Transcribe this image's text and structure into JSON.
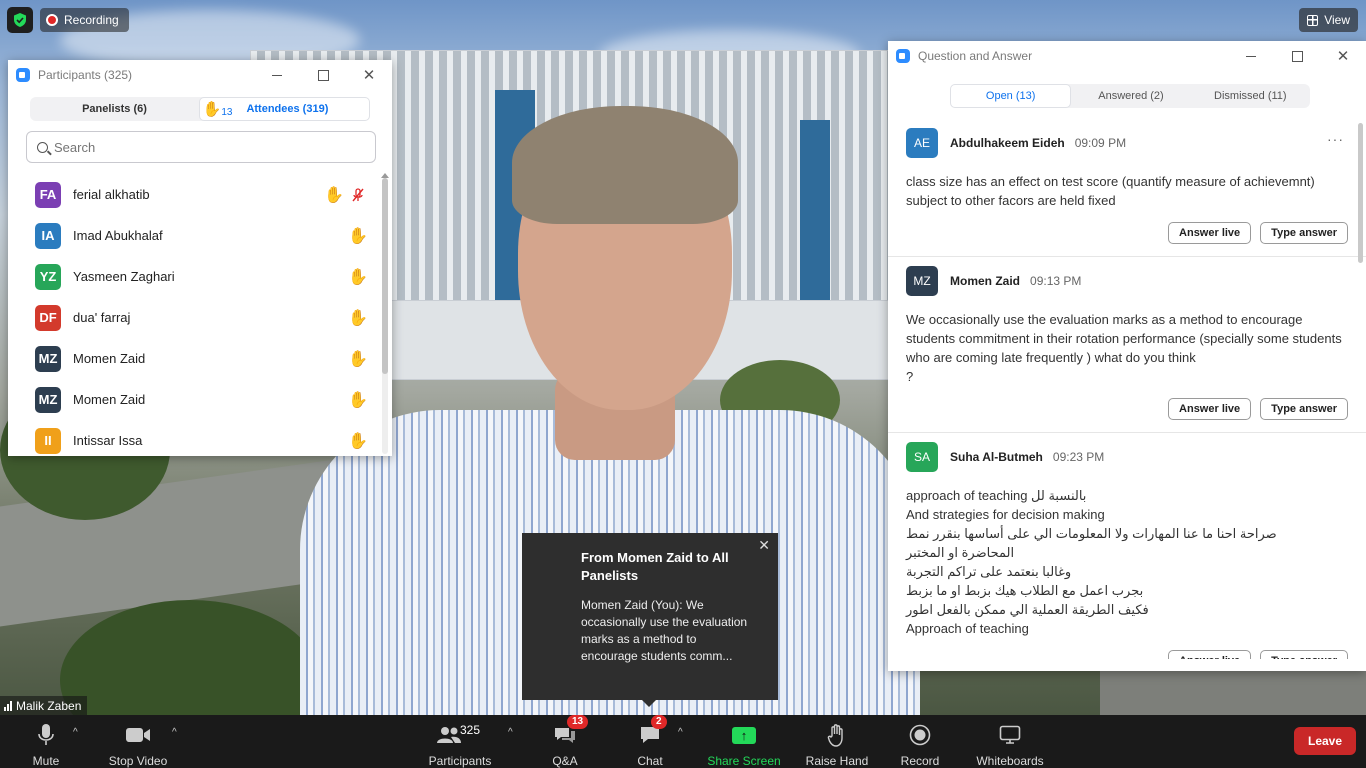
{
  "status": {
    "recording_label": "Recording",
    "view_label": "View"
  },
  "participants_window": {
    "title": "Participants (325)",
    "tabs": [
      {
        "label": "Panelists (6)"
      },
      {
        "label": "Attendees (319)"
      }
    ],
    "raised_hands_count": "13",
    "search_placeholder": "Search",
    "rows": [
      {
        "initials": "FA",
        "name": "ferial alkhatib",
        "color": "#7b3fb3",
        "hand": true,
        "mic_muted": true
      },
      {
        "initials": "IA",
        "name": "Imad Abukhalaf",
        "color": "#2b7cbf",
        "hand": true
      },
      {
        "initials": "YZ",
        "name": "Yasmeen Zaghari",
        "color": "#27a659",
        "hand": true
      },
      {
        "initials": "DF",
        "name": "dua' farraj",
        "color": "#d33a2c",
        "hand": true
      },
      {
        "initials": "MZ",
        "name": "Momen Zaid",
        "color": "#2d3e50",
        "hand": true
      },
      {
        "initials": "MZ",
        "name": "Momen Zaid",
        "color": "#2d3e50",
        "hand": true
      },
      {
        "initials": "II",
        "name": "Intissar Issa",
        "color": "#f0a01a",
        "hand": true
      }
    ]
  },
  "qa_window": {
    "title": "Question and Answer",
    "tabs": [
      {
        "label": "Open (13)"
      },
      {
        "label": "Answered (2)"
      },
      {
        "label": "Dismissed (11)"
      }
    ],
    "more_label": "···",
    "answer_live_label": "Answer live",
    "type_answer_label": "Type answer",
    "questions": [
      {
        "initials": "AE",
        "color": "#2b7cbf",
        "name": "Abdulhakeem Eideh",
        "time": "09:09 PM",
        "text": "class size has an effect on test score (quantify measure of achievemnt) subject to other facors are held fixed"
      },
      {
        "initials": "MZ",
        "color": "#2d3e50",
        "name": "Momen Zaid",
        "time": "09:13 PM",
        "text": "We occasionally use the evaluation marks as a method to encourage students commitment in their rotation performance (specially some students who are coming late frequently  ) what do you think\n?"
      },
      {
        "initials": "SA",
        "color": "#27a659",
        "name": "Suha Al-Butmeh",
        "time": "09:23 PM",
        "text": "approach of teaching بالنسبة لل\nAnd strategies for decision making\nصراحة احنا ما عنا المهارات ولا المعلومات الي على أساسها بنقرر نمط\nالمحاضرة او المختبر\nوغالبا بنعتمد على تراكم التجربة\nبجرب اعمل مع الطلاب هيك بزبط او ما بزبط\nفكيف الطريقة العملية الي ممكن بالفعل اطور\nApproach of teaching"
      }
    ]
  },
  "chat_toast": {
    "from": "From Momen Zaid to All Panelists",
    "message": "Momen Zaid (You): We occasionally use the evaluation marks as a method to encourage students comm..."
  },
  "video": {
    "speaker_name": "Malik Zaben"
  },
  "toolbar": {
    "mute": "Mute",
    "stop_video": "Stop Video",
    "participants": "Participants",
    "participants_count": "325",
    "qa": "Q&A",
    "qa_badge": "13",
    "chat": "Chat",
    "chat_badge": "2",
    "share_screen": "Share Screen",
    "raise_hand": "Raise Hand",
    "record": "Record",
    "whiteboards": "Whiteboards",
    "leave": "Leave"
  },
  "colors": {
    "accent_blue": "#0e72ed",
    "share_green": "#23d959",
    "leave_red": "#c92828",
    "hand_yellow": "#f5b400"
  }
}
